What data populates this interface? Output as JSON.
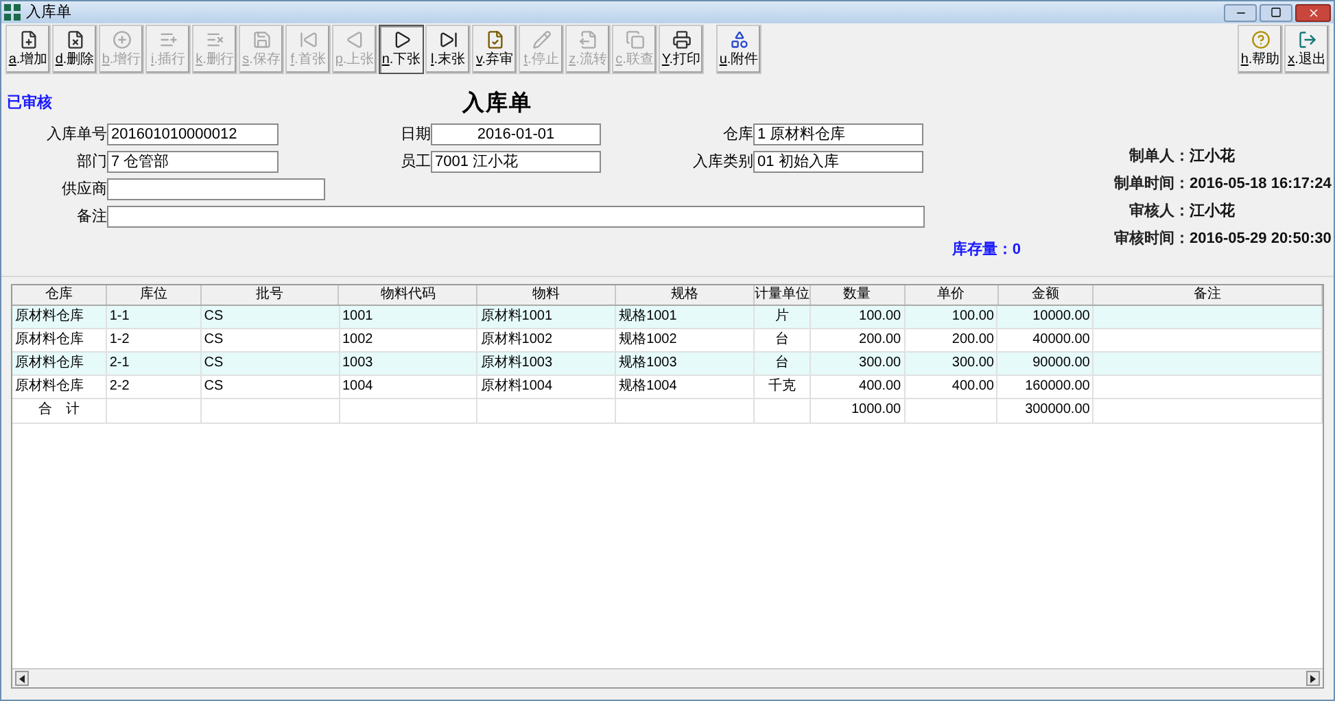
{
  "window": {
    "title": "入库单"
  },
  "toolbar_groups": [
    [
      {
        "key": "a",
        "label": ".增加",
        "disabled": false,
        "focused": false
      },
      {
        "key": "d",
        "label": ".删除",
        "disabled": false,
        "focused": false
      },
      {
        "key": "b",
        "label": ".增行",
        "disabled": true,
        "focused": false
      },
      {
        "key": "i",
        "label": ".插行",
        "disabled": true,
        "focused": false
      },
      {
        "key": "k",
        "label": ".删行",
        "disabled": true,
        "focused": false
      },
      {
        "key": "s",
        "label": ".保存",
        "disabled": true,
        "focused": false
      },
      {
        "key": "f",
        "label": ".首张",
        "disabled": true,
        "focused": false
      },
      {
        "key": "p",
        "label": ".上张",
        "disabled": true,
        "focused": false
      },
      {
        "key": "n",
        "label": ".下张",
        "disabled": false,
        "focused": true
      },
      {
        "key": "l",
        "label": ".末张",
        "disabled": false,
        "focused": false
      },
      {
        "key": "v",
        "label": ".弃审",
        "disabled": false,
        "focused": false
      },
      {
        "key": "t",
        "label": ".停止",
        "disabled": true,
        "focused": false
      },
      {
        "key": "z",
        "label": ".流转",
        "disabled": true,
        "focused": false
      },
      {
        "key": "c",
        "label": ".联查",
        "disabled": true,
        "focused": false
      },
      {
        "key": "Y",
        "label": ".打印",
        "disabled": false,
        "focused": false
      }
    ],
    [
      {
        "key": "u",
        "label": ".附件",
        "disabled": false,
        "focused": false
      }
    ]
  ],
  "toolbar_right": [
    {
      "key": "h",
      "label": ".帮助",
      "disabled": false,
      "focused": false
    },
    {
      "key": "x",
      "label": ".退出",
      "disabled": false,
      "focused": false
    }
  ],
  "status": "已审核",
  "form_title": "入库单",
  "form_rows": [
    [
      {
        "label": "入库单号",
        "value": "201601010000012"
      },
      {
        "label": "日期",
        "value": "2016-01-01"
      },
      {
        "label": "仓库",
        "value": "1 原材料仓库"
      }
    ],
    [
      {
        "label": "部门",
        "value": "7 仓管部"
      },
      {
        "label": "员工",
        "value": "7001 江小花"
      },
      {
        "label": "入库类别",
        "value": "01 初始入库"
      }
    ],
    [
      {
        "label": "供应商"
      }
    ],
    [
      {
        "label": "备注"
      }
    ]
  ],
  "stock": {
    "label": "库存量：",
    "value": "0"
  },
  "info": [
    {
      "label": "制单人：",
      "value": "江小花"
    },
    {
      "label": "制单时间：",
      "value": "2016-05-18 16:17:24"
    },
    {
      "label": "审核人：",
      "value": "江小花"
    },
    {
      "label": "审核时间：",
      "value": "2016-05-29 20:50:30"
    }
  ],
  "table": {
    "columns": [
      "仓库",
      "库位",
      "批号",
      "物料代码",
      "物料",
      "规格",
      "计量单位",
      "数量",
      "单价",
      "金额",
      "备注"
    ],
    "rows": [
      [
        "原材料仓库",
        "1-1",
        "CS",
        "1001",
        "原材料1001",
        "规格1001",
        "片",
        "100.00",
        "100.00",
        "10000.00"
      ],
      [
        "原材料仓库",
        "1-2",
        "CS",
        "1002",
        "原材料1002",
        "规格1002",
        "台",
        "200.00",
        "200.00",
        "40000.00"
      ],
      [
        "原材料仓库",
        "2-1",
        "CS",
        "1003",
        "原材料1003",
        "规格1003",
        "台",
        "300.00",
        "300.00",
        "90000.00"
      ],
      [
        "原材料仓库",
        "2-2",
        "CS",
        "1004",
        "原材料1004",
        "规格1004",
        "千克",
        "400.00",
        "400.00",
        "160000.00"
      ]
    ],
    "total": {
      "label": "合　计",
      "quantity": "1000.00",
      "amount": "300000.00"
    }
  }
}
